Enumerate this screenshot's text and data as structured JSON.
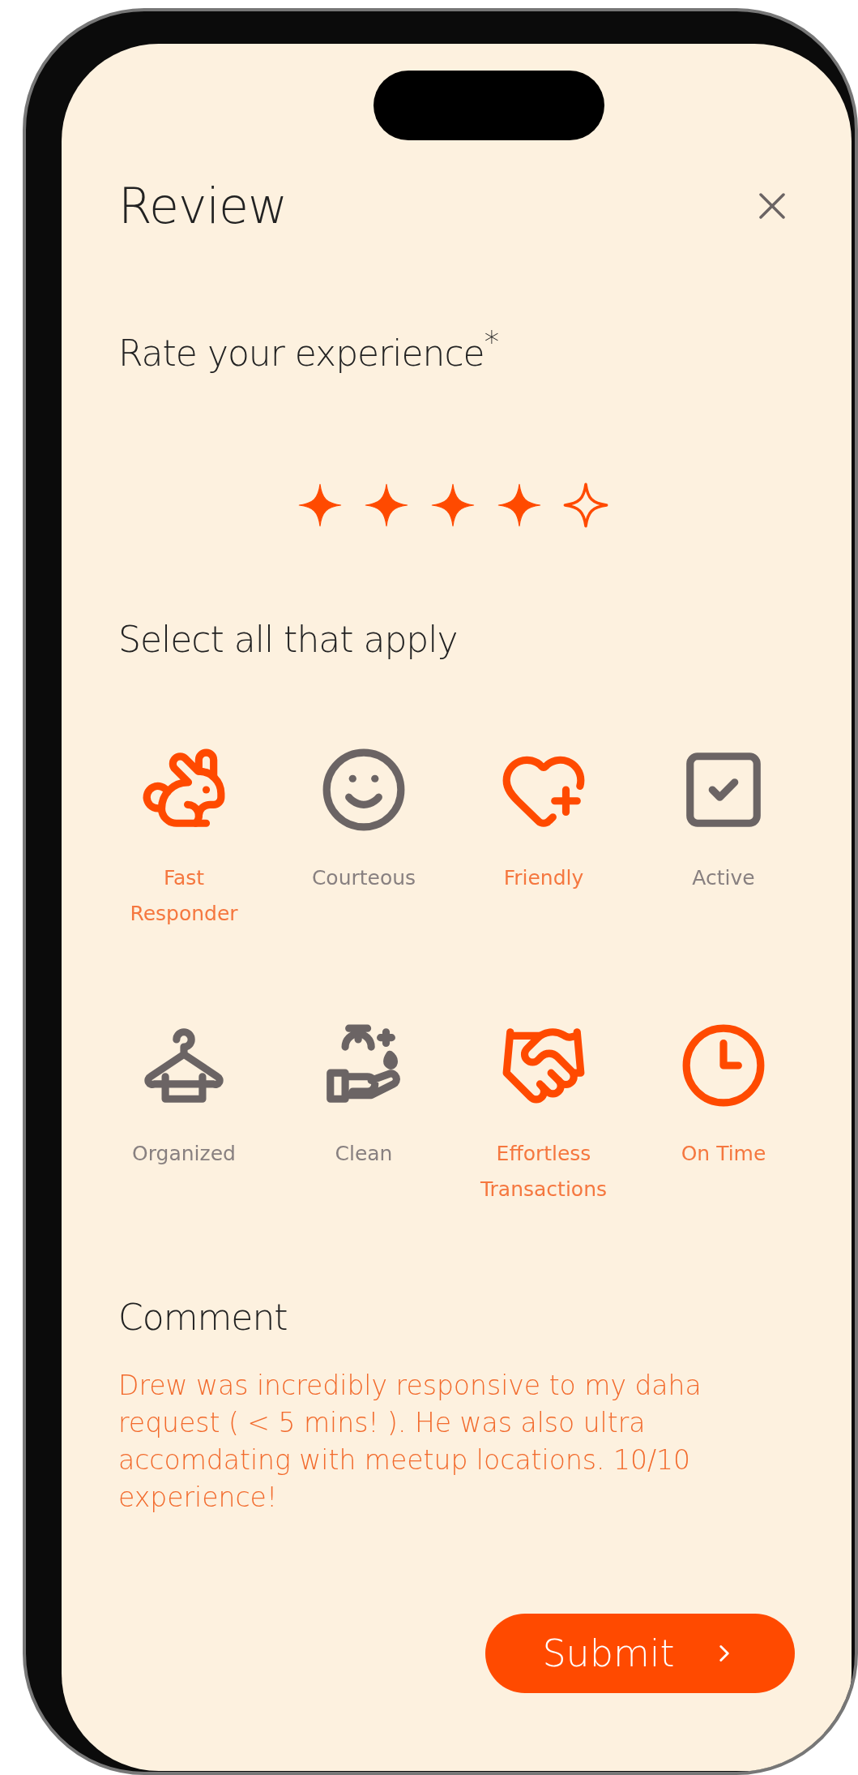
{
  "header": {
    "title": "Review"
  },
  "rating": {
    "label": "Rate your experience$^{*}$",
    "stars": 4
  },
  "attributes": {
    "heading": "Select all that apply",
    "items": [
      {
        "label": "Fast Responder",
        "selected": true
      },
      {
        "label": "Courteous",
        "selected": false
      },
      {
        "label": "Friendly",
        "selected": true
      },
      {
        "label": "Active",
        "selected": false
      },
      {
        "label": "Organized",
        "selected": false
      },
      {
        "label": "Clean",
        "selected": false
      },
      {
        "label": "Effortless Transactions",
        "selected": true
      },
      {
        "label": "On Time",
        "selected": true
      }
    ]
  },
  "comment": {
    "heading": "Comment",
    "text": "Drew was incredibly responsive to my daha request ( < 5 mins! ). He was also ultra accomdating with meetup locations. 10/10 experience!"
  },
  "submit": {
    "label": "Submit"
  }
}
